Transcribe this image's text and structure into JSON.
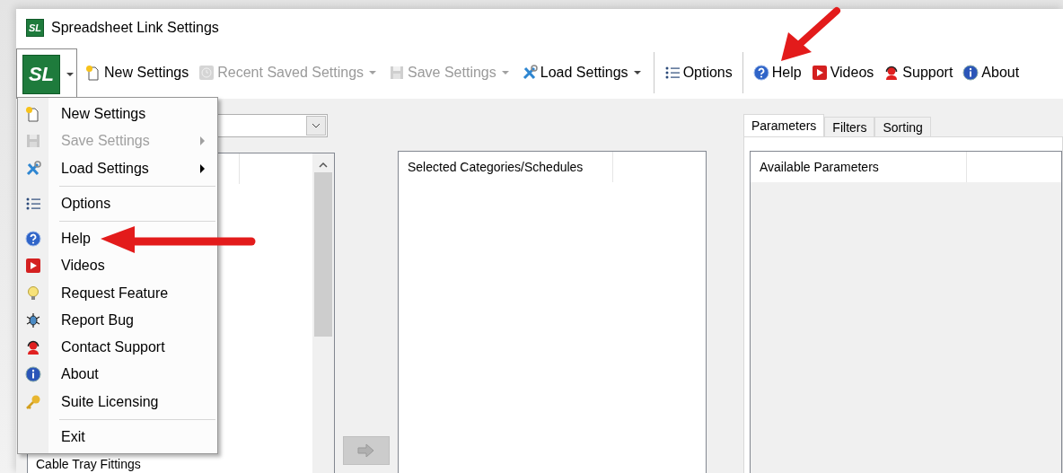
{
  "window": {
    "title": "Spreadsheet Link Settings",
    "logo_text": "SL"
  },
  "toolbar": {
    "app_button": {
      "label": "SL",
      "open": true
    },
    "items": [
      {
        "kind": "button",
        "label": "New Settings",
        "disabled": false,
        "dropdown": false
      },
      {
        "kind": "button",
        "label": "Recent Saved Settings",
        "disabled": true,
        "dropdown": true
      },
      {
        "kind": "button",
        "label": "Save Settings",
        "disabled": true,
        "dropdown": true
      },
      {
        "kind": "button",
        "label": "Load Settings",
        "disabled": false,
        "dropdown": true
      },
      {
        "kind": "separator"
      },
      {
        "kind": "button",
        "label": "Options",
        "disabled": false,
        "dropdown": false
      },
      {
        "kind": "separator"
      },
      {
        "kind": "button",
        "label": "Help",
        "disabled": false,
        "dropdown": false
      },
      {
        "kind": "button",
        "label": "Videos",
        "disabled": false,
        "dropdown": false
      },
      {
        "kind": "button",
        "label": "Support",
        "disabled": false,
        "dropdown": false
      },
      {
        "kind": "button",
        "label": "About",
        "disabled": false,
        "dropdown": false
      }
    ]
  },
  "app_menu": [
    {
      "kind": "item",
      "label": "New Settings",
      "disabled": false,
      "submenu": false
    },
    {
      "kind": "item",
      "label": "Save Settings",
      "disabled": true,
      "submenu": true
    },
    {
      "kind": "item",
      "label": "Load Settings",
      "disabled": false,
      "submenu": true
    },
    {
      "kind": "separator"
    },
    {
      "kind": "item",
      "label": "Options",
      "disabled": false,
      "submenu": false
    },
    {
      "kind": "separator"
    },
    {
      "kind": "item",
      "label": "Help",
      "disabled": false,
      "submenu": false
    },
    {
      "kind": "item",
      "label": "Videos",
      "disabled": false,
      "submenu": false
    },
    {
      "kind": "item",
      "label": "Request Feature",
      "disabled": false,
      "submenu": false
    },
    {
      "kind": "item",
      "label": "Report Bug",
      "disabled": false,
      "submenu": false
    },
    {
      "kind": "item",
      "label": "Contact Support",
      "disabled": false,
      "submenu": false
    },
    {
      "kind": "item",
      "label": "About",
      "disabled": false,
      "submenu": false
    },
    {
      "kind": "item",
      "label": "Suite Licensing",
      "disabled": false,
      "submenu": false
    },
    {
      "kind": "separator"
    },
    {
      "kind": "item",
      "label": "Exit",
      "disabled": false,
      "submenu": false
    }
  ],
  "categories_list": {
    "rows": [
      "Cable Tray Fittings"
    ]
  },
  "add_button": {
    "disabled": true
  },
  "selected_list": {
    "columns": [
      "Selected Categories/Schedules"
    ]
  },
  "tabs": [
    {
      "label": "Parameters",
      "selected": true
    },
    {
      "label": "Filters",
      "selected": false
    },
    {
      "label": "Sorting",
      "selected": false
    }
  ],
  "parameters_list": {
    "columns": [
      "Available Parameters"
    ]
  }
}
